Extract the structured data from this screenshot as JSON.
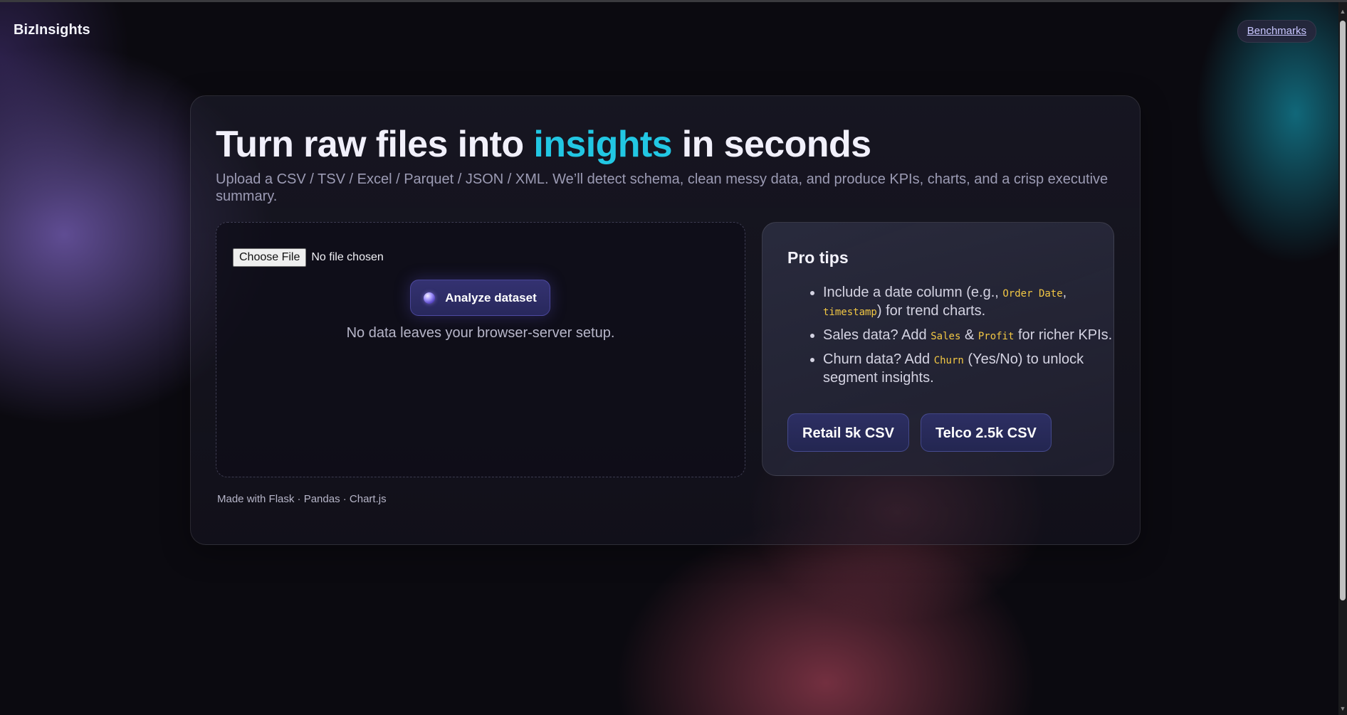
{
  "header": {
    "brand": "BizInsights",
    "benchmarks_link": "Benchmarks"
  },
  "hero": {
    "title_before": "Turn raw files into ",
    "title_accent": "insights",
    "title_after": " in seconds",
    "subtitle": "Upload a CSV / TSV / Excel / Parquet / JSON / XML. We’ll detect schema, clean messy data, and produce KPIs, charts, and a crisp executive summary."
  },
  "upload": {
    "choose_file_label": "Choose File",
    "file_status": "No file chosen",
    "analyze_label": "Analyze dataset",
    "privacy_note": "No data leaves your browser-server setup."
  },
  "tips": {
    "title": "Pro tips",
    "items": [
      {
        "t1": "Include a date column (e.g., ",
        "c1": "Order Date",
        "t2": ", ",
        "c2": "timestamp",
        "t3": ") for trend charts."
      },
      {
        "t1": "Sales data? Add ",
        "c1": "Sales",
        "t2": " & ",
        "c2": "Profit",
        "t3": " for richer KPIs."
      },
      {
        "t1": "Churn data? Add ",
        "c1": "Churn",
        "t2": " (Yes/No) to unlock segment insights."
      }
    ],
    "samples": [
      "Retail 5k CSV",
      "Telco 2.5k CSV"
    ]
  },
  "footer": {
    "text": "Made with Flask · Pandas · Chart.js"
  },
  "colors": {
    "accent": "#22c7e3",
    "code": "#f2c744",
    "background": "#0b0a10"
  }
}
